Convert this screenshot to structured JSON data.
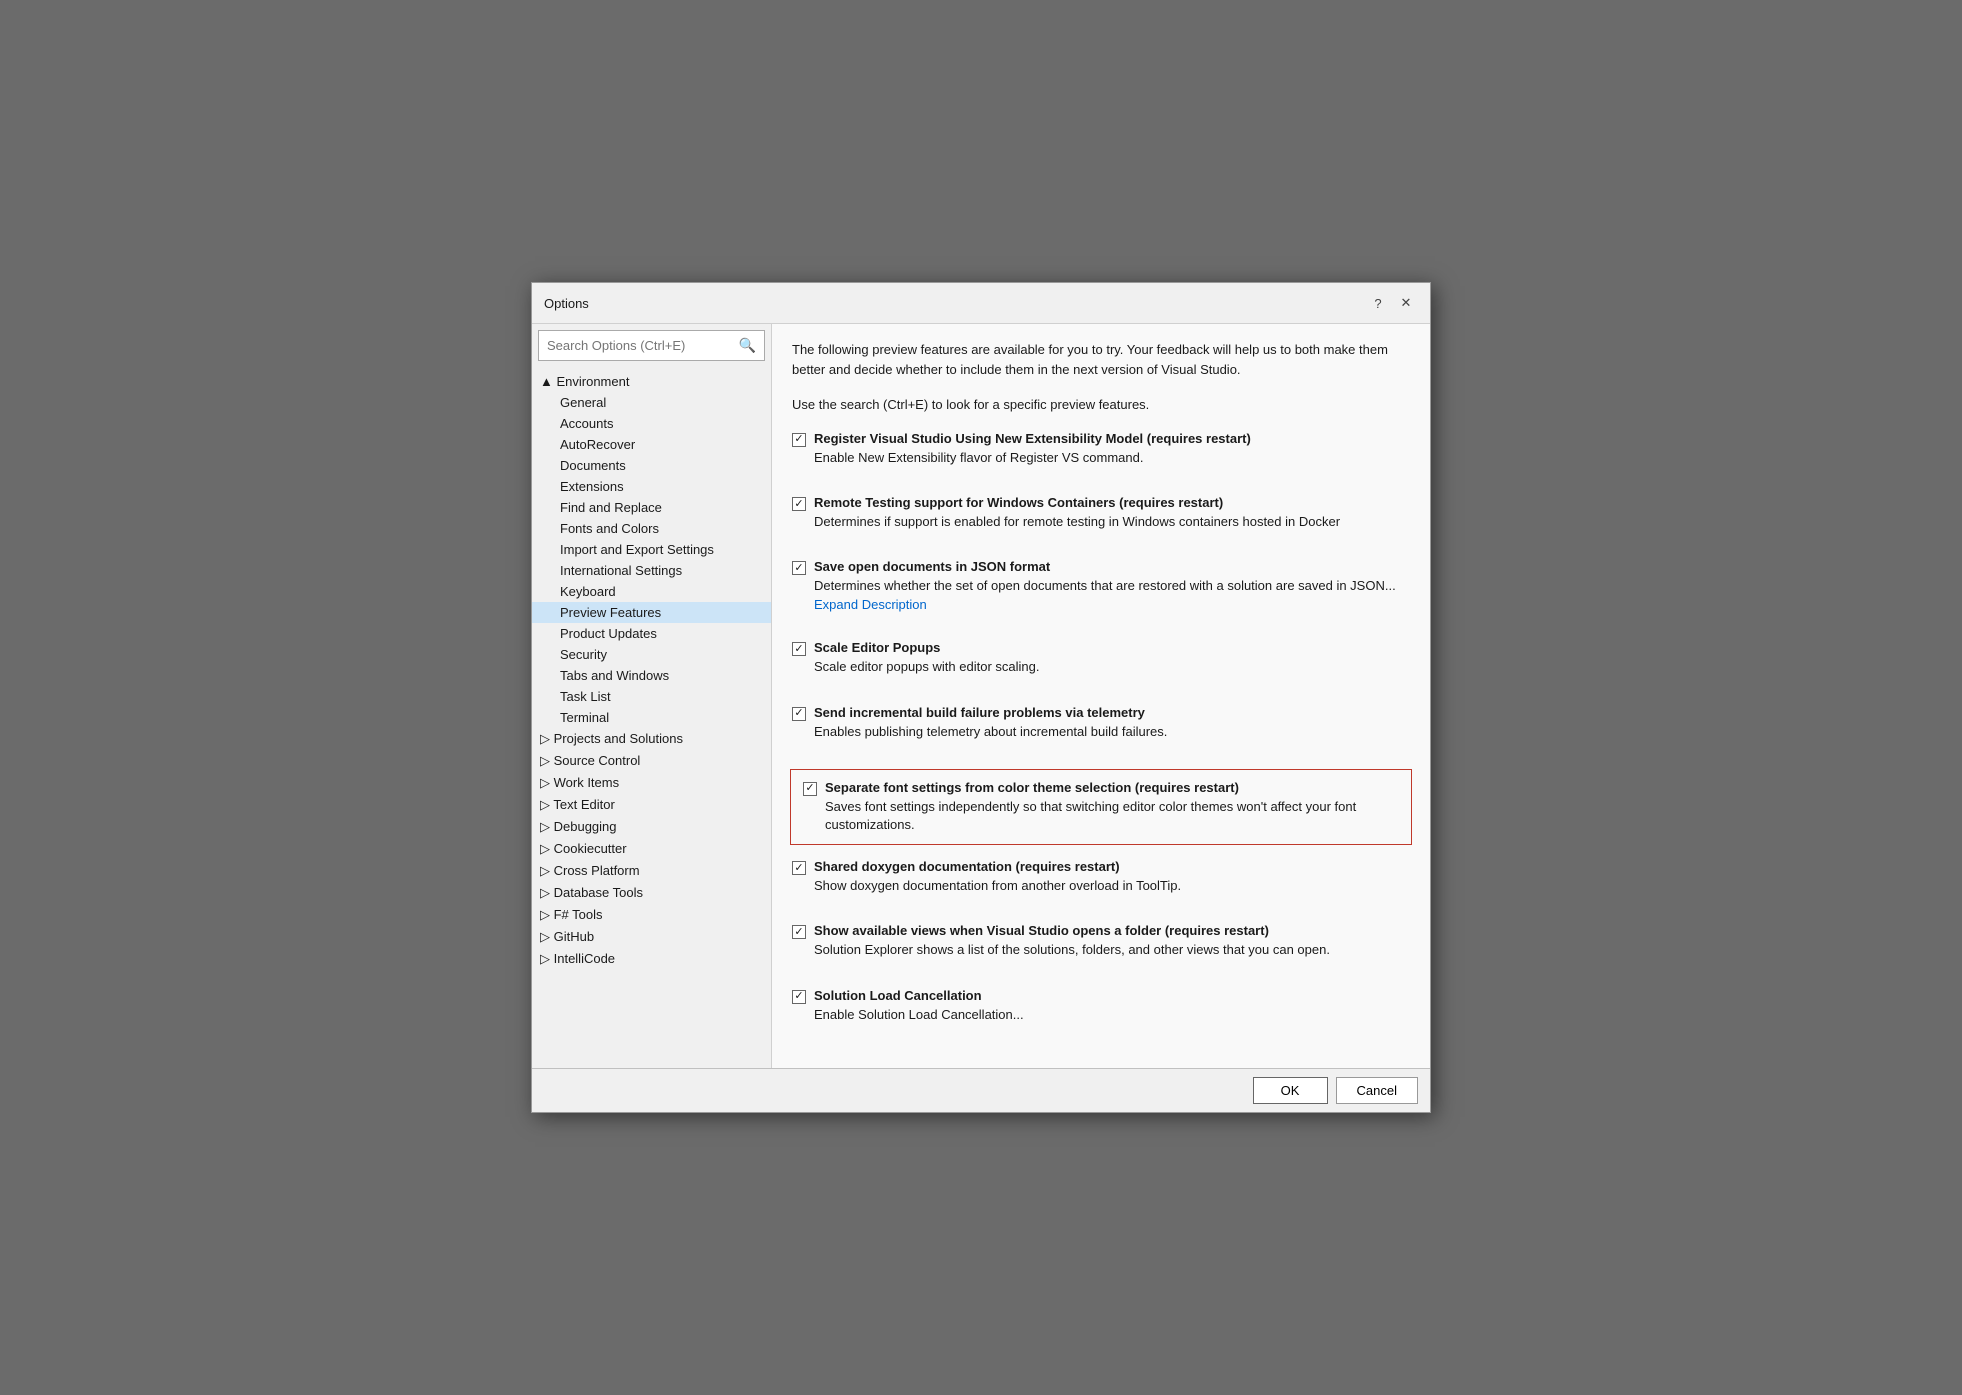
{
  "dialog": {
    "title": "Options",
    "help_btn": "?",
    "close_btn": "✕"
  },
  "search": {
    "placeholder": "Search Options (Ctrl+E)"
  },
  "tree": {
    "items": [
      {
        "label": "▲ Environment",
        "type": "parent",
        "expanded": true,
        "indent": 0
      },
      {
        "label": "General",
        "type": "child",
        "indent": 1
      },
      {
        "label": "Accounts",
        "type": "child",
        "indent": 1
      },
      {
        "label": "AutoRecover",
        "type": "child",
        "indent": 1
      },
      {
        "label": "Documents",
        "type": "child",
        "indent": 1
      },
      {
        "label": "Extensions",
        "type": "child",
        "indent": 1
      },
      {
        "label": "Find and Replace",
        "type": "child",
        "indent": 1
      },
      {
        "label": "Fonts and Colors",
        "type": "child",
        "indent": 1
      },
      {
        "label": "Import and Export Settings",
        "type": "child",
        "indent": 1
      },
      {
        "label": "International Settings",
        "type": "child",
        "indent": 1
      },
      {
        "label": "Keyboard",
        "type": "child",
        "indent": 1
      },
      {
        "label": "Preview Features",
        "type": "child",
        "indent": 1,
        "selected": true
      },
      {
        "label": "Product Updates",
        "type": "child",
        "indent": 1
      },
      {
        "label": "Security",
        "type": "child",
        "indent": 1
      },
      {
        "label": "Tabs and Windows",
        "type": "child",
        "indent": 1
      },
      {
        "label": "Task List",
        "type": "child",
        "indent": 1
      },
      {
        "label": "Terminal",
        "type": "child",
        "indent": 1
      },
      {
        "label": "▷ Projects and Solutions",
        "type": "parent",
        "indent": 0
      },
      {
        "label": "▷ Source Control",
        "type": "parent",
        "indent": 0
      },
      {
        "label": "▷ Work Items",
        "type": "parent",
        "indent": 0
      },
      {
        "label": "▷ Text Editor",
        "type": "parent",
        "indent": 0
      },
      {
        "label": "▷ Debugging",
        "type": "parent",
        "indent": 0
      },
      {
        "label": "▷ Cookiecutter",
        "type": "parent",
        "indent": 0
      },
      {
        "label": "▷ Cross Platform",
        "type": "parent",
        "indent": 0
      },
      {
        "label": "▷ Database Tools",
        "type": "parent",
        "indent": 0
      },
      {
        "label": "▷ F# Tools",
        "type": "parent",
        "indent": 0
      },
      {
        "label": "▷ GitHub",
        "type": "parent",
        "indent": 0
      },
      {
        "label": "▷ IntelliCode",
        "type": "parent",
        "indent": 0
      }
    ]
  },
  "right_panel": {
    "intro": "The following preview features are available for you to try. Your feedback will help us to both make them better and decide whether to include them in the next version of Visual Studio.",
    "intro2": "Use the search (Ctrl+E) to look for a specific preview features.",
    "features": [
      {
        "id": "register-vs",
        "checked": true,
        "title": "Register Visual Studio Using New Extensibility Model (requires restart)",
        "desc": "Enable New Extensibility flavor of Register VS command.",
        "link": null,
        "highlighted": false
      },
      {
        "id": "remote-testing",
        "checked": true,
        "title": "Remote Testing support for Windows Containers (requires restart)",
        "desc": "Determines if support is enabled for remote testing in Windows containers hosted in Docker",
        "link": null,
        "highlighted": false
      },
      {
        "id": "save-json",
        "checked": true,
        "title": "Save open documents in JSON format",
        "desc": "Determines whether the set of open documents that are restored with a solution are saved in JSON...",
        "link": "Expand Description",
        "highlighted": false
      },
      {
        "id": "scale-editor",
        "checked": true,
        "title": "Scale Editor Popups",
        "desc": "Scale editor popups with editor scaling.",
        "link": null,
        "highlighted": false
      },
      {
        "id": "incremental-build",
        "checked": true,
        "title": "Send incremental build failure problems via telemetry",
        "desc": "Enables publishing telemetry about incremental build failures.",
        "link": null,
        "highlighted": false
      },
      {
        "id": "separate-font",
        "checked": true,
        "title": "Separate font settings from color theme selection (requires restart)",
        "desc": "Saves font settings independently so that switching editor color themes won't affect your font customizations.",
        "link": null,
        "highlighted": true
      },
      {
        "id": "shared-doxygen",
        "checked": true,
        "title": "Shared doxygen documentation (requires restart)",
        "desc": "Show doxygen documentation from another overload in ToolTip.",
        "link": null,
        "highlighted": false
      },
      {
        "id": "show-views",
        "checked": true,
        "title": "Show available views when Visual Studio opens a folder (requires restart)",
        "desc": "Solution Explorer shows a list of the solutions, folders, and other views that you can open.",
        "link": null,
        "highlighted": false
      },
      {
        "id": "solution-load",
        "checked": true,
        "title": "Solution Load Cancellation",
        "desc": "Enable Solution Load Cancellation...",
        "link": null,
        "highlighted": false
      }
    ]
  },
  "footer": {
    "ok_label": "OK",
    "cancel_label": "Cancel"
  }
}
